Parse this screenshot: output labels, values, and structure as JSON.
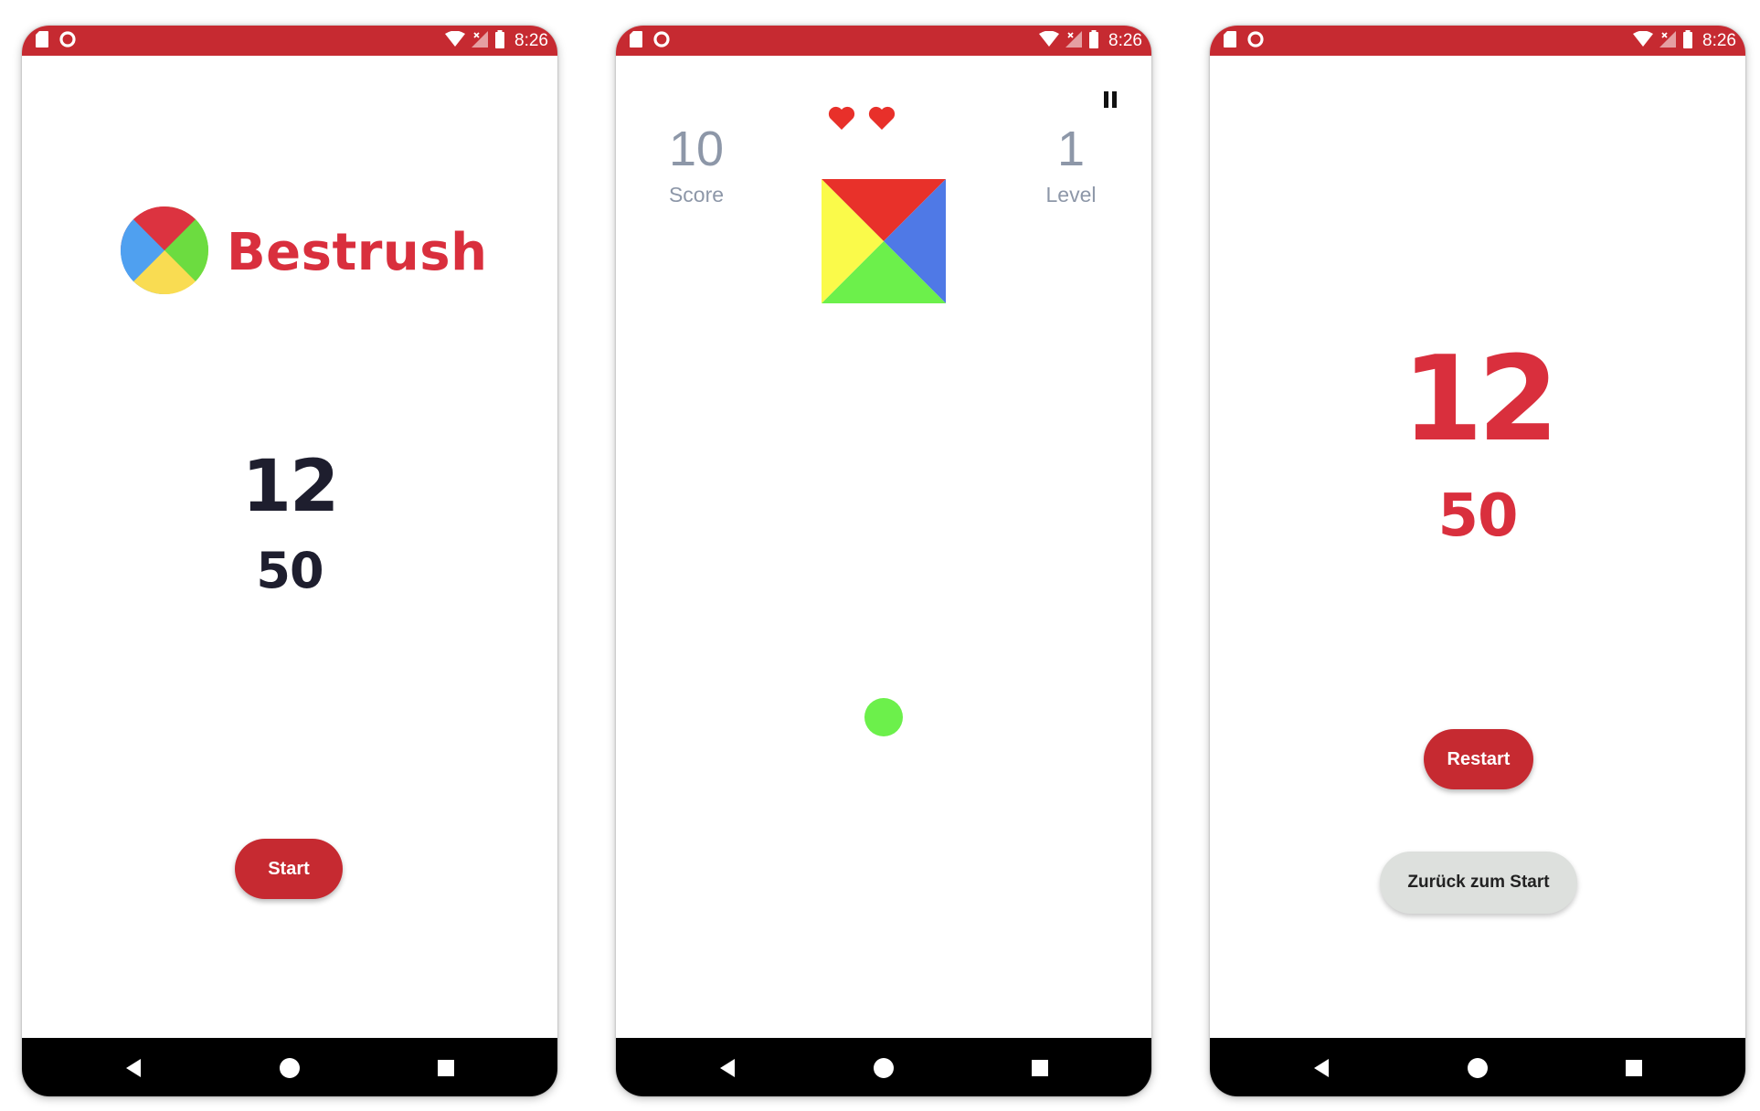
{
  "colors": {
    "status_bar": "#c62a31",
    "brand_red": "#d92f3d",
    "dark_text": "#1e1e2e",
    "stat_gray": "#8d97a8",
    "nav_bar": "#000000",
    "ball_green": "#6cf04b",
    "secondary_button": "#dde0dd"
  },
  "status_bar": {
    "time": "8:26",
    "icons": [
      "sd-card-icon",
      "record-icon",
      "wifi-icon",
      "cell-signal-icon",
      "battery-icon"
    ]
  },
  "nav_bar": {
    "icons": [
      "back-icon",
      "home-icon",
      "recents-icon"
    ]
  },
  "screens": [
    {
      "name": "start-screen",
      "app_title": "Bestrush",
      "last_score": "12",
      "best_score": "50",
      "start_button": "Start"
    },
    {
      "name": "game-screen",
      "score_value": "10",
      "score_label": "Score",
      "level_value": "1",
      "level_label": "Level",
      "lives": 2,
      "square_colors": {
        "top": "#e8312a",
        "right": "#4f79e6",
        "bottom": "#6cf04b",
        "left": "#fafa4a"
      },
      "ball_color": "#6cf04b"
    },
    {
      "name": "game-over-screen",
      "score": "12",
      "best_score": "50",
      "restart_button": "Restart",
      "back_to_start_button": "Zurück zum Start"
    }
  ]
}
